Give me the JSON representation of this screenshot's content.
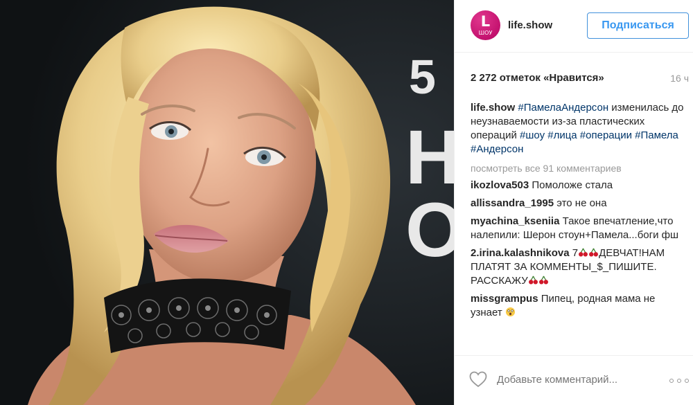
{
  "post": {
    "account": {
      "username": "life.show",
      "avatar_glyph": "L",
      "avatar_sub": "ШОУ",
      "avatar_color": "#d0237f"
    },
    "follow_label": "Подписаться",
    "likes": "2 272 отметок «Нравится»",
    "age": "16 ч",
    "caption": {
      "username": "life.show",
      "tag1": "#ПамелаАндерсон",
      "text": " изменилась до неузнаваемости из-за пластических операций ",
      "tags_tail": "#шоу #лица #операции #Памела #Андерсон"
    },
    "view_all": "посмотреть все 91 комментариев",
    "comments": [
      {
        "user": "ikozlova503",
        "text": "Помоложе стала"
      },
      {
        "user": "allissandra_1995",
        "text": "это не она"
      },
      {
        "user": "myachina_kseniia",
        "text": "Такое впечатление,что налепили: Шерон стоун+Памела...боги фш"
      },
      {
        "user": "2.irina.kalashnikova",
        "text_a": "7",
        "text_b": "ДЕВЧАТ!НАМ ПЛАТЯТ ЗА КОММЕНТЫ_$_ПИШИТЕ. РАССКАЖУ"
      },
      {
        "user": "missgrampus",
        "text": "Пипец, родная мама не узнает"
      }
    ],
    "add_comment_placeholder": "Добавьте комментарий...",
    "icons": {
      "like": "heart-outline-icon",
      "more": "more-options-icon",
      "emoji_cherries": "cherries-emoji-icon",
      "emoji_astonished": "astonished-face-emoji-icon"
    },
    "colors": {
      "link": "#003569",
      "follow": "#3897f0",
      "muted": "#999999",
      "text": "#262626"
    }
  }
}
